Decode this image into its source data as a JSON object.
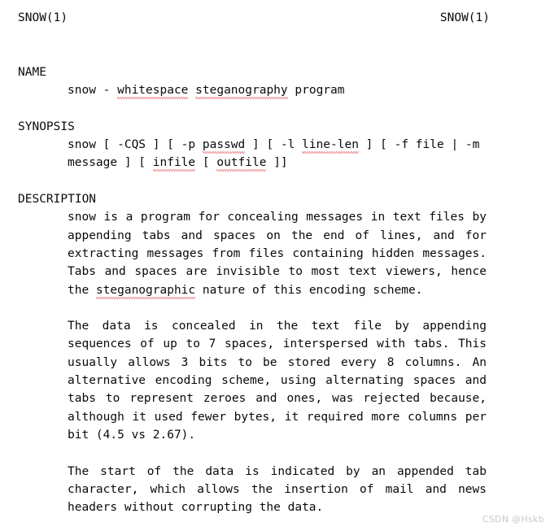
{
  "document": {
    "type": "man-page",
    "page_title": "SNOW(1)",
    "background_color": "#ffffff",
    "text_color": "#0a0a0a",
    "spellcheck_underline_color": "#d62020"
  },
  "header": {
    "left": "SNOW(1)",
    "right": "SNOW(1)"
  },
  "sections": {
    "name": {
      "heading": "NAME",
      "line_prefix": "snow - ",
      "misspelled_1": "whitespace",
      "between_1": " ",
      "misspelled_2": "steganography",
      "line_suffix": " program"
    },
    "synopsis": {
      "heading": "SYNOPSIS",
      "l1_a": "snow [ -CQS ] [ -p ",
      "l1_sq1": "passwd",
      "l1_b": " ] [ -l ",
      "l1_sq2": "line-len",
      "l1_c": " ] [ -f file | -m",
      "l2_a": "message ] [ ",
      "l2_sq1": "infile",
      "l2_b": " [ ",
      "l2_sq2": "outfile",
      "l2_c": " ]]"
    },
    "description": {
      "heading": "DESCRIPTION",
      "p1_line1": "snow is a program for concealing messages in text files by",
      "p1_line2": "appending tabs and spaces on the end of lines, and for",
      "p1_line3": "extracting messages from files containing hidden messages.",
      "p1_line4": "Tabs and spaces are invisible to most text viewers, hence",
      "p1_line5_a": "the ",
      "p1_line5_sq": "steganographic",
      "p1_line5_b": " nature of this encoding scheme.",
      "p2_line1": "The data is concealed in the text file by appending",
      "p2_line2": "sequences of up to 7 spaces, interspersed with tabs. This",
      "p2_line3": "usually allows 3 bits to be stored every 8 columns. An",
      "p2_line4": "alternative encoding scheme, using alternating spaces and",
      "p2_line5": "tabs to represent zeroes and ones, was rejected because,",
      "p2_line6": "although it used fewer bytes, it required more columns per",
      "p2_line7": "bit (4.5 vs 2.67).",
      "p3_line1": "The start of the data is indicated by an appended tab",
      "p3_line2": "character, which allows the insertion of mail and news",
      "p3_line3": "headers without corrupting the data."
    }
  },
  "watermark": {
    "text": "CSDN @Hskb"
  }
}
